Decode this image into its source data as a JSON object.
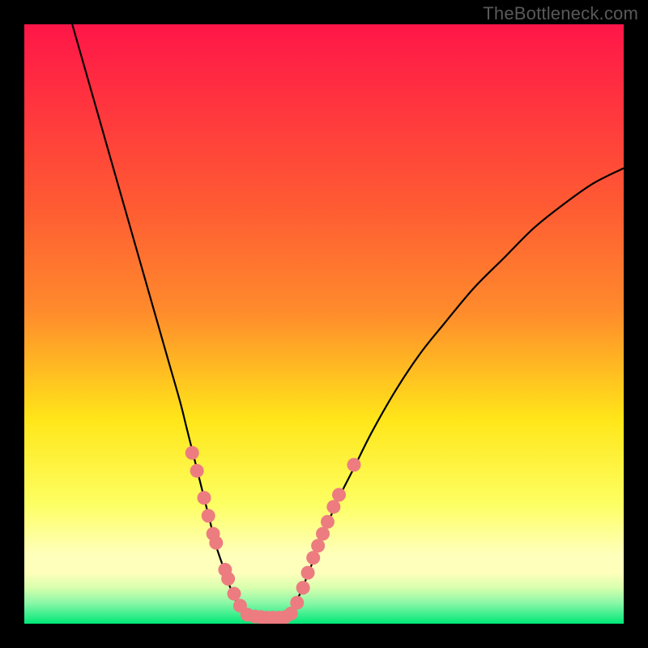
{
  "watermark": "TheBottleneck.com",
  "colors": {
    "frame": "#000000",
    "gradient_top": "#ff1648",
    "gradient_mid1": "#ff8b2c",
    "gradient_mid2": "#ffe619",
    "gradient_mid3": "#fdff62",
    "gradient_lightband": "#ffffbc",
    "gradient_green": "#00e878",
    "curve": "#000000",
    "marker": "#ec7c80"
  },
  "chart_data": {
    "type": "line",
    "title": "",
    "xlabel": "",
    "ylabel": "",
    "xlim": [
      0,
      100
    ],
    "ylim": [
      0,
      100
    ],
    "grid": false,
    "legend": false,
    "series": [
      {
        "name": "left-branch",
        "x": [
          8,
          10,
          12,
          14,
          16,
          18,
          20,
          22,
          24,
          26,
          27,
          28,
          29,
          30,
          31,
          32,
          33,
          34,
          35,
          36,
          37
        ],
        "y": [
          100,
          93,
          86,
          79,
          72,
          65,
          58,
          51,
          44,
          37,
          33,
          29,
          25,
          21,
          17,
          13,
          10,
          7,
          4.5,
          2.5,
          1.5
        ]
      },
      {
        "name": "valley",
        "x": [
          37,
          38,
          39,
          40,
          41,
          42,
          43,
          44
        ],
        "y": [
          1.5,
          1.2,
          1.0,
          1.0,
          1.0,
          1.0,
          1.0,
          1.2
        ]
      },
      {
        "name": "right-branch",
        "x": [
          44,
          46,
          48,
          50,
          52,
          55,
          58,
          62,
          66,
          70,
          75,
          80,
          85,
          90,
          95,
          100
        ],
        "y": [
          1.2,
          5,
          10,
          15,
          20,
          26,
          32,
          39,
          45,
          50,
          56,
          61,
          66,
          70,
          73.5,
          76
        ]
      }
    ],
    "markers": [
      {
        "x": 28.0,
        "y": 28.5
      },
      {
        "x": 28.8,
        "y": 25.5
      },
      {
        "x": 30.0,
        "y": 21.0
      },
      {
        "x": 30.7,
        "y": 18.0
      },
      {
        "x": 31.5,
        "y": 15.0
      },
      {
        "x": 32.0,
        "y": 13.5
      },
      {
        "x": 33.5,
        "y": 9.0
      },
      {
        "x": 34.0,
        "y": 7.5
      },
      {
        "x": 35.0,
        "y": 5.0
      },
      {
        "x": 36.0,
        "y": 3.0
      },
      {
        "x": 37.2,
        "y": 1.5
      },
      {
        "x": 38.5,
        "y": 1.2
      },
      {
        "x": 39.5,
        "y": 1.1
      },
      {
        "x": 40.5,
        "y": 1.0
      },
      {
        "x": 41.5,
        "y": 1.0
      },
      {
        "x": 42.5,
        "y": 1.0
      },
      {
        "x": 43.5,
        "y": 1.1
      },
      {
        "x": 44.5,
        "y": 1.7
      },
      {
        "x": 45.5,
        "y": 3.5
      },
      {
        "x": 46.5,
        "y": 6.0
      },
      {
        "x": 47.3,
        "y": 8.5
      },
      {
        "x": 48.2,
        "y": 11.0
      },
      {
        "x": 49.0,
        "y": 13.0
      },
      {
        "x": 49.8,
        "y": 15.0
      },
      {
        "x": 50.6,
        "y": 17.0
      },
      {
        "x": 51.6,
        "y": 19.5
      },
      {
        "x": 52.5,
        "y": 21.5
      },
      {
        "x": 55.0,
        "y": 26.5
      }
    ]
  }
}
